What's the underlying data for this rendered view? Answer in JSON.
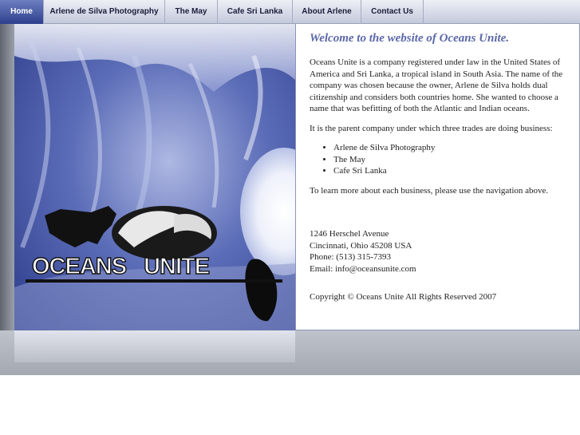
{
  "nav": {
    "items": [
      {
        "label": "Home",
        "active": true
      },
      {
        "label": "Arlene de Silva Photography",
        "active": false
      },
      {
        "label": "The May",
        "active": false
      },
      {
        "label": "Cafe Sri Lanka",
        "active": false
      },
      {
        "label": "About Arlene",
        "active": false
      },
      {
        "label": "Contact Us",
        "active": false
      }
    ]
  },
  "hero": {
    "logo_word_1": "OCEANS",
    "logo_word_2": "UNITE"
  },
  "content": {
    "welcome": "Welcome to the website of Oceans Unite.",
    "intro": "Oceans Unite is a company registered under law in the United States of America and Sri Lanka, a tropical island in South Asia. The name of the company was chosen because the owner, Arlene de Silva holds dual citizenship and considers both countries home. She wanted to choose a name that was befitting of both the Atlantic and Indian oceans.",
    "parent": "It is the parent company under which three trades are doing business:",
    "businesses": [
      "Arlene de Silva Photography",
      "The May",
      "Cafe Sri Lanka"
    ],
    "learn_more": "To learn more about each business, please use the navigation above.",
    "address": {
      "street": "1246 Herschel Avenue",
      "city": "Cincinnati, Ohio 45208 USA",
      "phone": "Phone: (513) 315-7393",
      "email": "Email: info@oceansunite.com"
    },
    "copyright": "Copyright © Oceans Unite All Rights Reserved 2007"
  },
  "colors": {
    "nav_active": "#2d3f8c",
    "welcome_text": "#5a68a8",
    "hero_blue": "#2c3b8a"
  }
}
